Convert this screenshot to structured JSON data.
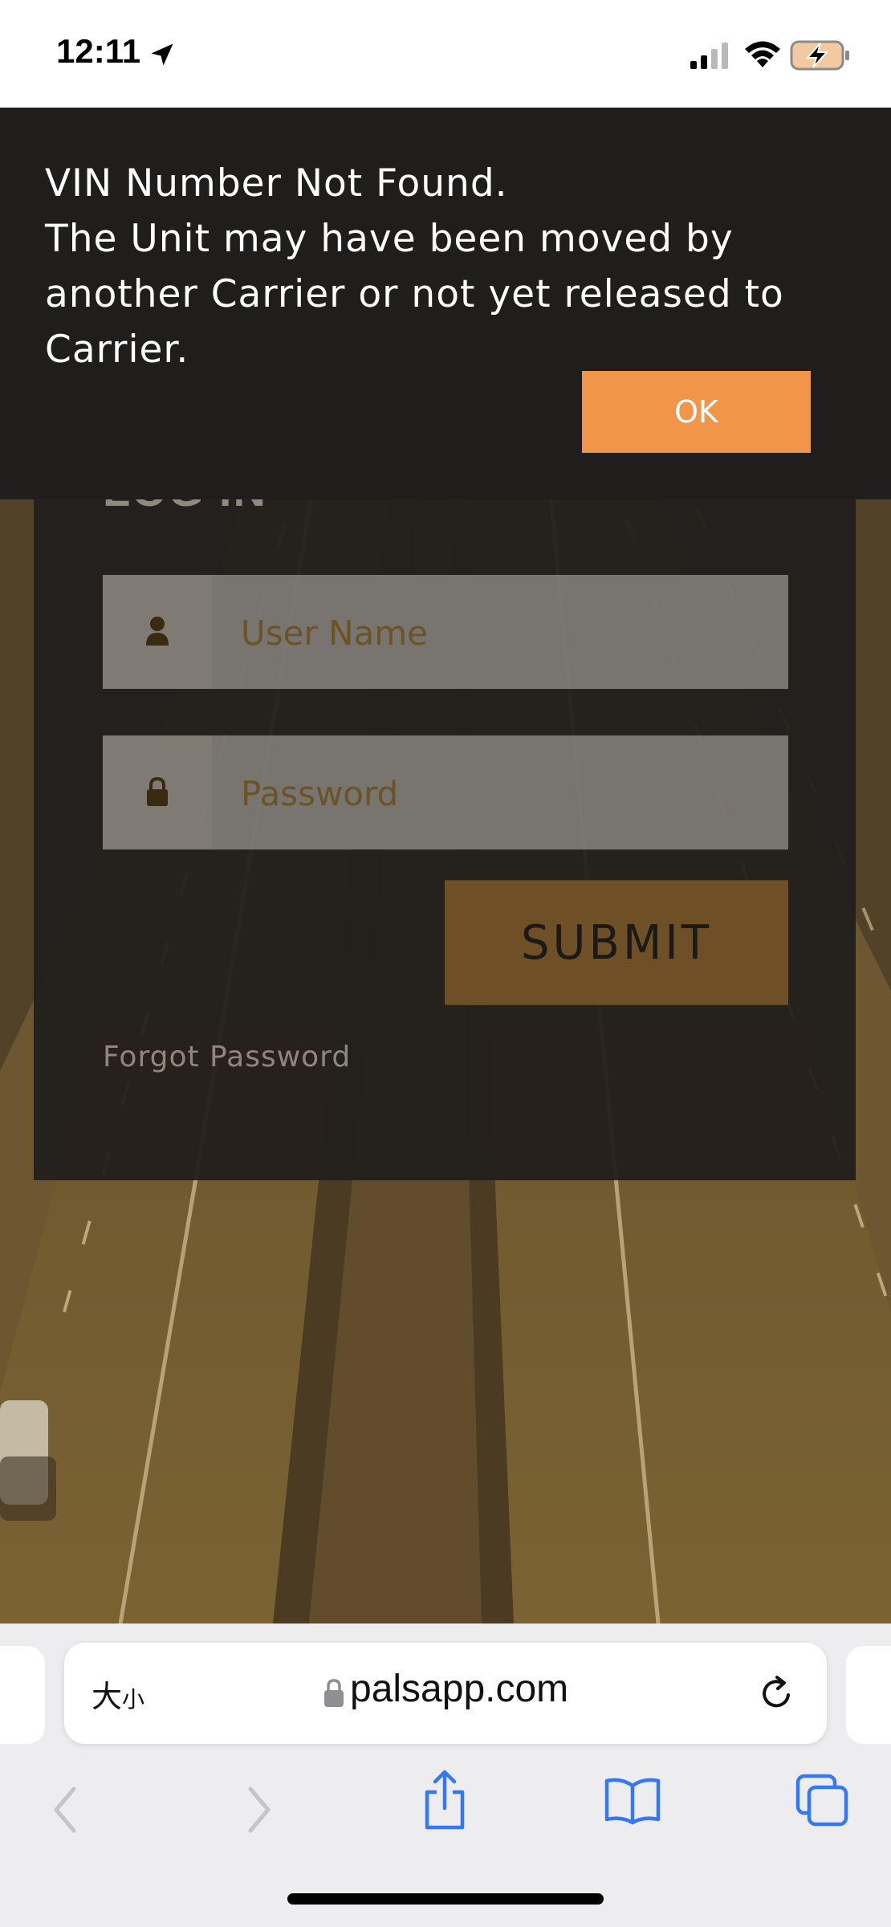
{
  "status_bar": {
    "time": "12:11",
    "icons": [
      "location-arrow-icon",
      "cellular-signal-icon",
      "wifi-icon",
      "battery-charging-icon"
    ]
  },
  "alert": {
    "message_lines": [
      "VIN Number Not Found.",
      "The Unit may have been moved by",
      "another Carrier or not yet released to",
      "Carrier."
    ],
    "ok_label": "OK"
  },
  "login": {
    "title": "LOG IN",
    "username_placeholder": "User Name",
    "password_placeholder": "Password",
    "submit_label": "SUBMIT",
    "forgot_label": "Forgot Password"
  },
  "browser": {
    "text_size_big": "大",
    "text_size_small": "小",
    "url": "palsapp.com",
    "toolbar_icons": [
      "back-icon",
      "forward-icon",
      "share-icon",
      "bookmarks-icon",
      "tabs-icon"
    ]
  },
  "colors": {
    "accent": "#f0954a",
    "alert_bg": "#1f1e1d",
    "card_bg": "#221f1c",
    "ios_blue": "#3478f6"
  }
}
